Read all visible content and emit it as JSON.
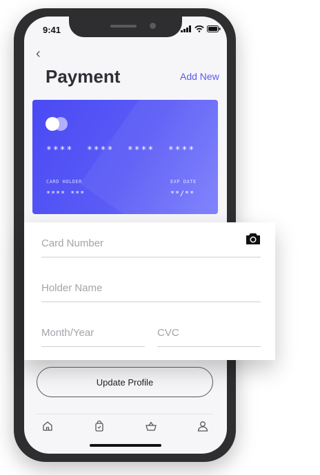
{
  "status_bar": {
    "time": "9:41"
  },
  "header": {
    "title": "Payment",
    "add_new_label": "Add New"
  },
  "card": {
    "number": "****  ****  ****  ****",
    "holder_label": "CARD HOLDER",
    "holder_value": "**** ***",
    "exp_label": "EXP DATE",
    "exp_value": "**/**"
  },
  "form": {
    "card_number_placeholder": "Card Number",
    "holder_name_placeholder": "Holder Name",
    "month_year_placeholder": "Month/Year",
    "cvc_placeholder": "CVC"
  },
  "actions": {
    "update_label": "Update Profile"
  },
  "tabbar": {
    "items": [
      "home-icon",
      "shopping-bag-icon",
      "basket-icon",
      "user-icon"
    ]
  },
  "colors": {
    "accent": "#5858f0",
    "card_start": "#4a4af4",
    "card_end": "#7a7dfc"
  }
}
